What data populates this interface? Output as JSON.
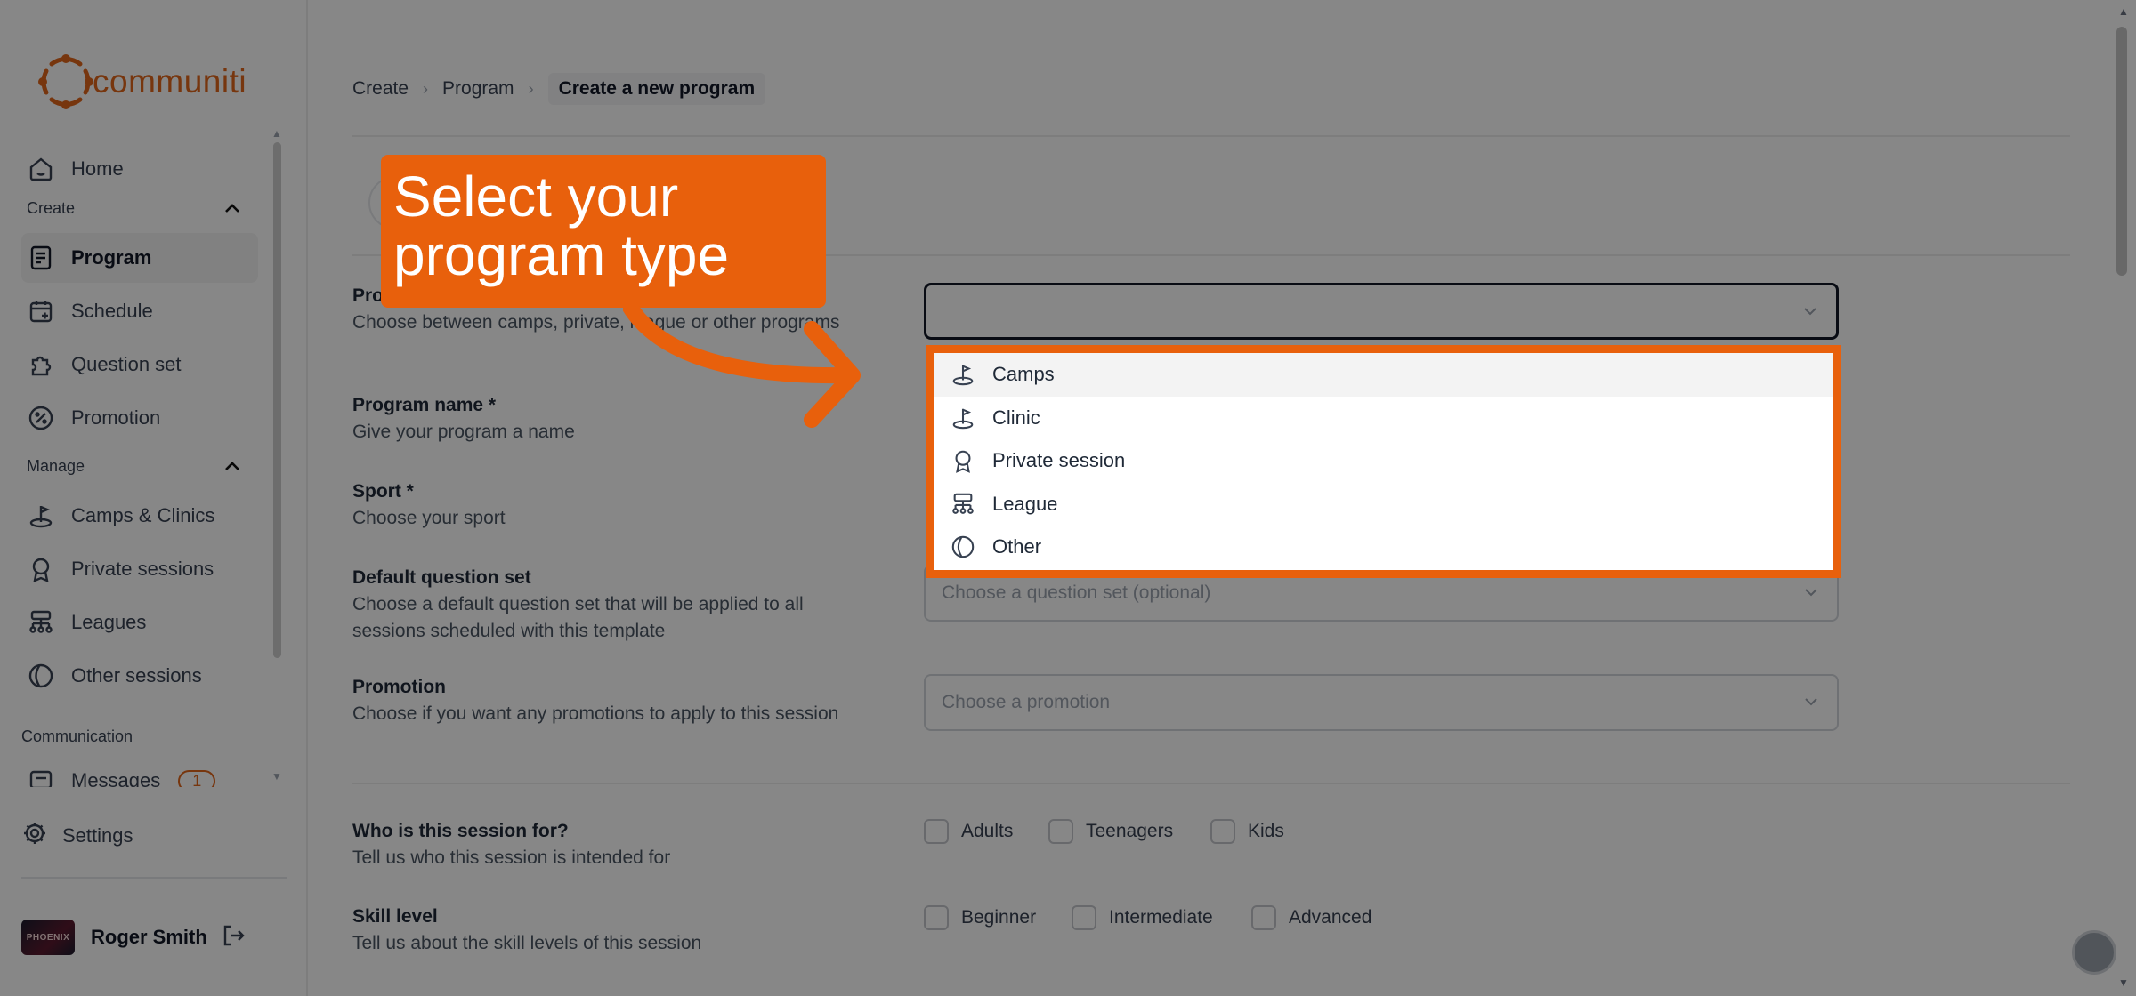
{
  "app": {
    "brand": "communiti",
    "accent": "#e8600c"
  },
  "sidebar": {
    "home": "Home",
    "create_section": "Create",
    "create_items": [
      "Program",
      "Schedule",
      "Question set",
      "Promotion"
    ],
    "manage_section": "Manage",
    "manage_items": [
      "Camps & Clinics",
      "Private sessions",
      "Leagues",
      "Other sessions"
    ],
    "communication_section": "Communication",
    "messages": "Messages",
    "messages_badge": "1",
    "settings": "Settings",
    "user_name": "Roger Smith",
    "avatar_text": "PHOENIX"
  },
  "breadcrumb": [
    "Create",
    "Program",
    "Create a new program"
  ],
  "form": {
    "program_type": {
      "title": "Pro",
      "desc": "Choose between camps, private, league or other programs"
    },
    "program_name": {
      "title": "Program name *",
      "desc": "Give your program a name"
    },
    "sport": {
      "title": "Sport *",
      "desc": "Choose your sport"
    },
    "question_set": {
      "title": "Default question set",
      "desc": "Choose a default question set that will be applied to all sessions scheduled with this template",
      "placeholder": "Choose a question set (optional)"
    },
    "promotion": {
      "title": "Promotion",
      "desc": "Choose if you want any promotions to apply to this session",
      "placeholder": "Choose a promotion"
    },
    "audience": {
      "title": "Who is this session for?",
      "desc": "Tell us who this session is intended for",
      "options": [
        "Adults",
        "Teenagers",
        "Kids"
      ]
    },
    "skill": {
      "title": "Skill level",
      "desc": "Tell us about the skill levels of this session",
      "options": [
        "Beginner",
        "Intermediate",
        "Advanced"
      ]
    }
  },
  "dropdown": {
    "options": [
      {
        "label": "Camps",
        "icon": "camps-icon"
      },
      {
        "label": "Clinic",
        "icon": "clinic-icon"
      },
      {
        "label": "Private session",
        "icon": "award-icon"
      },
      {
        "label": "League",
        "icon": "league-icon"
      },
      {
        "label": "Other",
        "icon": "other-icon"
      }
    ]
  },
  "callout": {
    "text": "Select your\nprogram type"
  }
}
